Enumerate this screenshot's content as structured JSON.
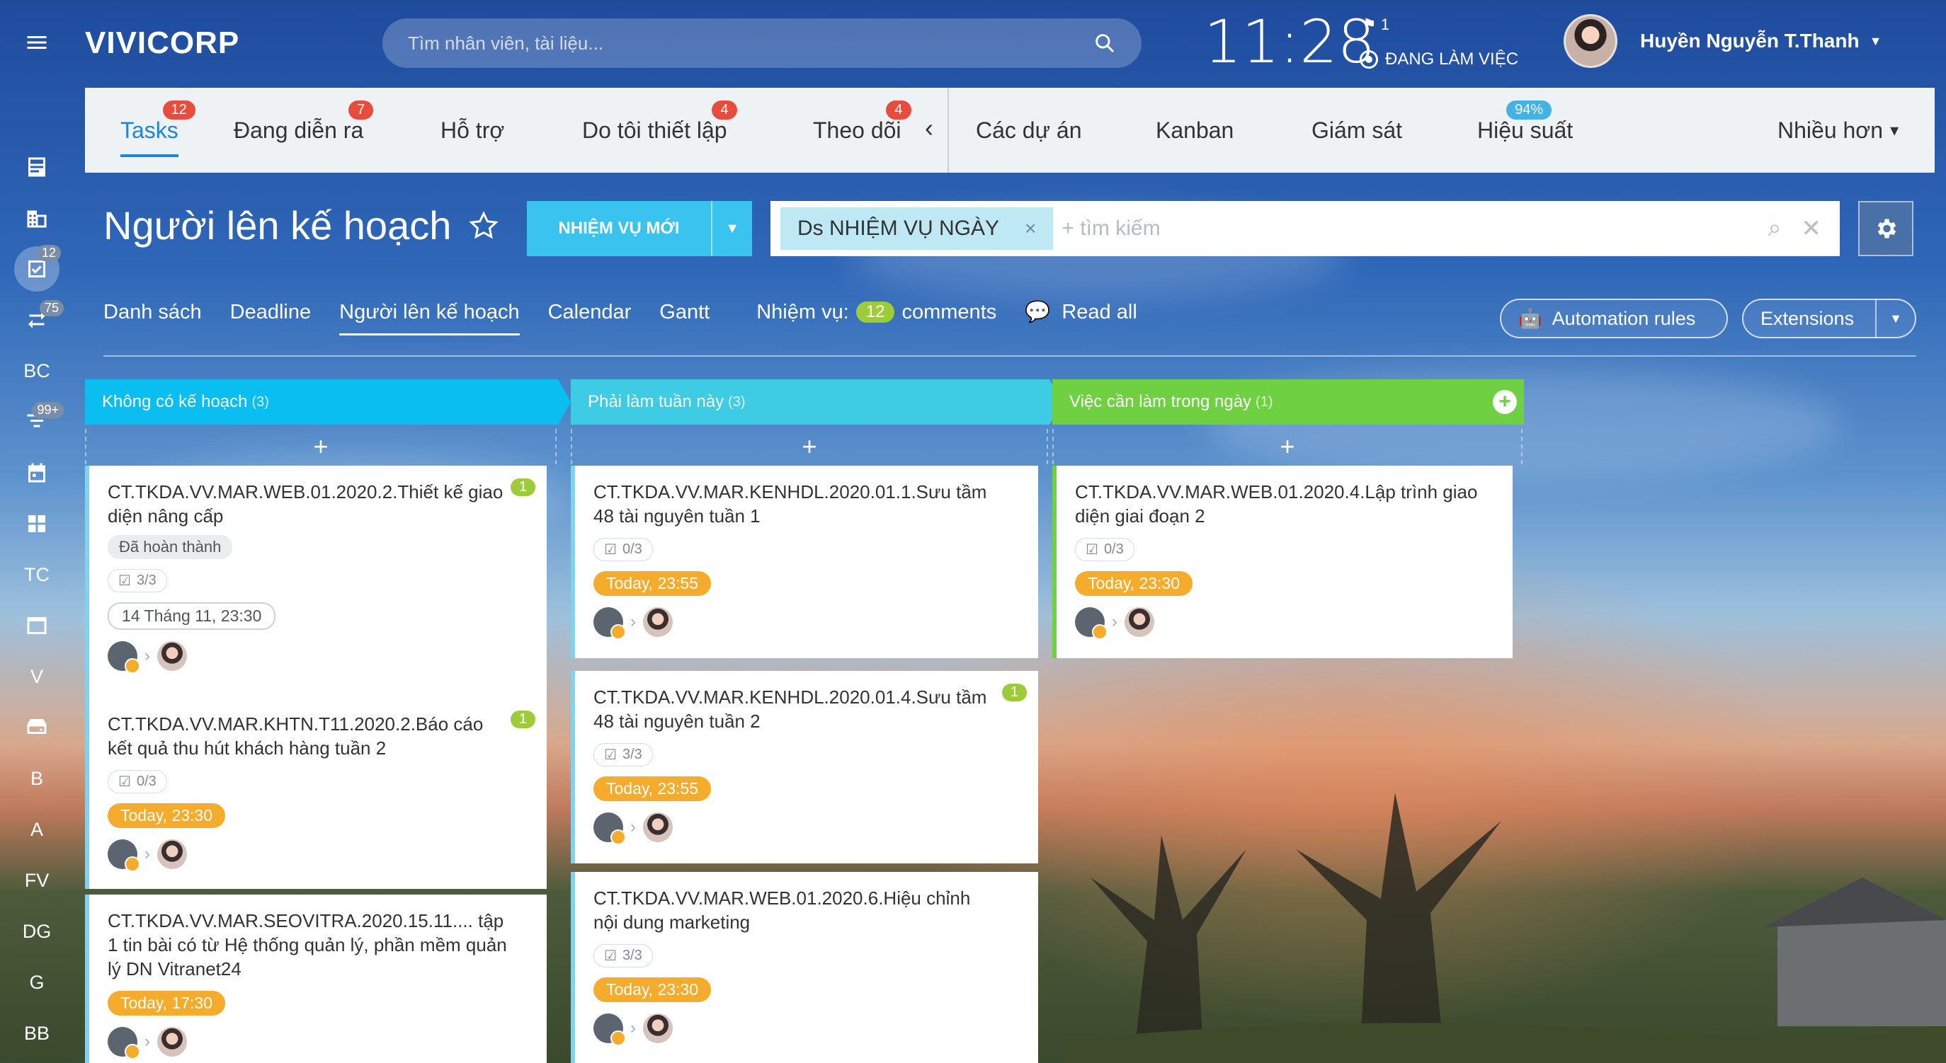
{
  "app": {
    "brand": "VIVICORP",
    "search_placeholder": "Tìm nhân viên, tài liệu...",
    "clock": "11:28",
    "flag_count": "1",
    "status": "ĐANG LÀM VIỆC",
    "user_name": "Huyền Nguyễn T.Thanh"
  },
  "sidebar": [
    {
      "label": "",
      "icon": "menu-icon"
    },
    {
      "label": "",
      "icon": "news-icon"
    },
    {
      "label": "",
      "icon": "company-icon"
    },
    {
      "label": "",
      "icon": "tasks-icon",
      "badge": "12",
      "active": true
    },
    {
      "label": "",
      "icon": "sync-icon",
      "badge": "75"
    },
    {
      "label": "BC",
      "icon": ""
    },
    {
      "label": "",
      "icon": "filter-icon",
      "badge": "99+"
    },
    {
      "label": "",
      "icon": "calendar-icon"
    },
    {
      "label": "",
      "icon": "apps-icon"
    },
    {
      "label": "TC",
      "icon": ""
    },
    {
      "label": "",
      "icon": "window-icon"
    },
    {
      "label": "V",
      "icon": ""
    },
    {
      "label": "",
      "icon": "drive-icon"
    },
    {
      "label": "B",
      "icon": ""
    },
    {
      "label": "A",
      "icon": ""
    },
    {
      "label": "FV",
      "icon": ""
    },
    {
      "label": "DG",
      "icon": ""
    },
    {
      "label": "G",
      "icon": ""
    },
    {
      "label": "BB",
      "icon": ""
    },
    {
      "label": "",
      "icon": "chevron-down-icon"
    }
  ],
  "tabs": [
    {
      "label": "Tasks",
      "badge": "12",
      "active": true
    },
    {
      "label": "Đang diễn ra",
      "badge": "7"
    },
    {
      "label": "Hỗ trợ",
      "badge": ""
    },
    {
      "label": "Do tôi thiết lập",
      "badge": "4"
    },
    {
      "label": "Theo dõi",
      "badge": "4"
    },
    {
      "label": "Các dự án",
      "badge": ""
    },
    {
      "label": "Kanban",
      "badge": ""
    },
    {
      "label": "Giám sát",
      "badge": ""
    },
    {
      "label": "Hiệu suất",
      "badge": "94%"
    },
    {
      "label": "Nhiều hơn",
      "badge": ""
    }
  ],
  "page": {
    "title": "Người lên kế hoạch",
    "new_task": "NHIỆM VỤ MỚI",
    "filter_chip": "Ds NHIỆM VỤ NGÀY",
    "filter_placeholder": "+ tìm kiếm"
  },
  "subnav": {
    "items": [
      "Danh sách",
      "Deadline",
      "Người lên kế hoạch",
      "Calendar",
      "Gantt"
    ],
    "tasks_label": "Nhiệm vụ:",
    "tasks_count": "12",
    "comments_label": "comments",
    "read_all": "Read all",
    "automation": "Automation rules",
    "extensions": "Extensions"
  },
  "columns": [
    {
      "title": "Không có kế hoạch",
      "count": "(3)",
      "color": "#0bbef2",
      "cards": [
        {
          "title": "CT.TKDA.VV.MAR.WEB.01.2020.2.Thiết kế giao diện nâng cấp",
          "comments": "1",
          "tag": "Đã hoàn thành",
          "checklist": "3/3",
          "deadline": "14 Tháng 11, 23:30",
          "deadline_style": "plain"
        },
        {
          "title": "CT.TKDA.VV.MAR.KHTN.T11.2020.2.Báo cáo kết quả thu hút khách hàng tuần 2",
          "comments": "1",
          "tag": "",
          "checklist": "0/3",
          "deadline": "Today, 23:30",
          "deadline_style": "orange"
        },
        {
          "title": "CT.TKDA.VV.MAR.SEOVITRA.2020.15.11.... tập 1 tin bài có từ Hệ thống quản lý, phần mềm quản lý DN Vitranet24",
          "comments": "",
          "tag": "",
          "checklist": "",
          "deadline": "Today, 17:30",
          "deadline_style": "orange"
        }
      ]
    },
    {
      "title": "Phải làm tuần này",
      "count": "(3)",
      "color": "#3ecbe4",
      "cards": [
        {
          "title": "CT.TKDA.VV.MAR.KENHDL.2020.01.1.Sưu tầm 48 tài nguyên tuần 1",
          "comments": "",
          "tag": "",
          "checklist": "0/3",
          "deadline": "Today, 23:55",
          "deadline_style": "orange"
        },
        {
          "title": "CT.TKDA.VV.MAR.KENHDL.2020.01.4.Sưu tầm 48 tài nguyên tuần 2",
          "comments": "1",
          "tag": "",
          "checklist": "3/3",
          "deadline": "Today, 23:55",
          "deadline_style": "orange"
        },
        {
          "title": "CT.TKDA.VV.MAR.WEB.01.2020.6.Hiệu chỉnh nội dung marketing",
          "comments": "",
          "tag": "",
          "checklist": "3/3",
          "deadline": "Today, 23:30",
          "deadline_style": "orange"
        }
      ]
    },
    {
      "title": "Việc cần làm trong ngày",
      "count": "(1)",
      "color": "#6fd041",
      "cards": [
        {
          "title": "CT.TKDA.VV.MAR.WEB.01.2020.4.Lập trình giao diện giai đoạn 2",
          "comments": "",
          "tag": "",
          "checklist": "0/3",
          "deadline": "Today, 23:30",
          "deadline_style": "orange"
        }
      ]
    }
  ]
}
